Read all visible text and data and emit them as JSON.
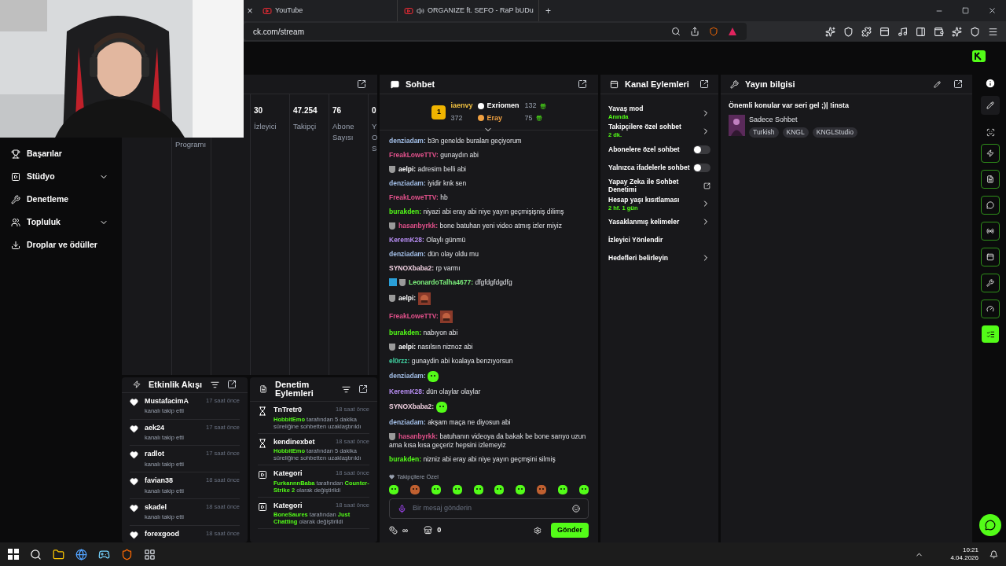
{
  "browser": {
    "tabs": [
      {
        "title": "YouTube",
        "selected": false,
        "audio": false
      },
      {
        "title": "ORGANIZE ft. SEFO - RaP bUDu",
        "selected": false,
        "audio": true
      }
    ],
    "close_mark": "×",
    "new_tab": "+",
    "address": "ck.com/stream"
  },
  "sidebar": {
    "items": [
      {
        "label": "Başarılar",
        "kind": "link"
      },
      {
        "label": "Stüdyo",
        "kind": "group"
      },
      {
        "label": "Denetleme",
        "kind": "link"
      },
      {
        "label": "Topluluk",
        "kind": "group"
      },
      {
        "label": "Droplar ve ödüller",
        "kind": "link"
      }
    ]
  },
  "stats": {
    "columns": [
      {
        "label": "Programı"
      },
      {},
      {
        "value": "30",
        "label": "İzleyici"
      },
      {
        "value": "47.254",
        "label": "Takipçi"
      },
      {
        "value": "76",
        "label": "Abone Sayısı"
      },
      {
        "value": "0",
        "label": "Y O S"
      }
    ]
  },
  "activity": {
    "title": "Etkinlik Akışı",
    "events": [
      {
        "user": "MustafacimA",
        "time": "17 saat önce",
        "action": "kanalı takip etti"
      },
      {
        "user": "aek24",
        "time": "17 saat önce",
        "action": "kanalı takip etti"
      },
      {
        "user": "radlot",
        "time": "17 saat önce",
        "action": "kanalı takip etti"
      },
      {
        "user": "favian38",
        "time": "18 saat önce",
        "action": "kanalı takip etti"
      },
      {
        "user": "skadel",
        "time": "18 saat önce",
        "action": "kanalı takip etti"
      },
      {
        "user": "forexgood",
        "time": "18 saat önce"
      }
    ]
  },
  "mod_actions": {
    "title": "Denetim Eylemleri",
    "items": [
      {
        "kind": "timeout",
        "title": "TnTretr0",
        "time": "18 saat önce",
        "text": "**HobbitEmo** tarafından 5 dakika süreliğine sohbetten uzaklaştırıldı"
      },
      {
        "kind": "timeout",
        "title": "kendinexbet",
        "time": "18 saat önce",
        "text": "**HobbitEmo** tarafından 5 dakika süreliğine sohbetten uzaklaştırıldı"
      },
      {
        "kind": "category",
        "title": "Kategori",
        "time": "18 saat önce",
        "text": "**FurkannnBaba** tarafından **Counter-Strike 2** olarak değiştirildi"
      },
      {
        "kind": "category",
        "title": "Kategori",
        "time": "18 saat önce",
        "text": "**BoneSaures** tarafından **Just Chatting** olarak değiştirildi"
      }
    ]
  },
  "chat": {
    "title": "Sohbet",
    "leaderboard": {
      "rank": "1",
      "first": {
        "user": "iaenvy",
        "count": "372"
      },
      "others": [
        {
          "user": "Exriomen",
          "count": "132",
          "color": "#ffffff"
        },
        {
          "user": "Eray",
          "count": "75",
          "color": "#f0a040"
        }
      ]
    },
    "messages": [
      {
        "user": "denziadam:",
        "color": "#a3bfe8",
        "kind": "text",
        "text": "b3n genelde buraları geçiyorum",
        "badge": false,
        "moderator": false
      },
      {
        "user": "FreakLoweTTV:",
        "color": "#e0508a",
        "kind": "text",
        "text": "gunaydın abi",
        "badge": false,
        "moderator": false
      },
      {
        "user": "aelpi:",
        "color": "#ffffff",
        "kind": "text",
        "text": "adresim belli abi",
        "badge": true,
        "moderator": false
      },
      {
        "user": "denziadam:",
        "color": "#a3bfe8",
        "kind": "text",
        "text": "iyidir knk sen",
        "badge": false,
        "moderator": false
      },
      {
        "user": "FreakLoweTTV:",
        "color": "#e0508a",
        "kind": "text",
        "text": "hb",
        "badge": false,
        "moderator": false
      },
      {
        "user": "burakden:",
        "color": "#53fc18",
        "kind": "text",
        "text": "niyazi abi eray abi niye yayın geçmişişniş dilimş",
        "badge": false,
        "moderator": false
      },
      {
        "user": "hasanbyrkk:",
        "color": "#e0508a",
        "kind": "text",
        "text": "bone batuhan yeni video atmış izler miyiz",
        "badge": true,
        "moderator": false
      },
      {
        "user": "KeremK28:",
        "color": "#b58cf0",
        "kind": "text",
        "text": "Olaylı günmü",
        "badge": false,
        "moderator": false
      },
      {
        "user": "denziadam:",
        "color": "#a3bfe8",
        "kind": "text",
        "text": "dün olay oldu mu",
        "badge": false,
        "moderator": false
      },
      {
        "user": "SYNOXbaba2:",
        "color": "#f0d0e0",
        "kind": "text",
        "text": "rp varmı",
        "badge": false,
        "moderator": false
      },
      {
        "user": "LeonardoTalha4677:",
        "color": "#7cf07c",
        "kind": "text",
        "text": "dfgfdgfdgdfg",
        "badge": true,
        "moderator": true
      },
      {
        "user": "aelpi:",
        "color": "#ffffff",
        "kind": "picture",
        "badge": true,
        "moderator": false
      },
      {
        "user": "FreakLoweTTV:",
        "color": "#e0508a",
        "kind": "picture",
        "badge": false,
        "moderator": false
      },
      {
        "user": "burakden:",
        "color": "#53fc18",
        "kind": "text",
        "text": "nabıyon abi",
        "badge": false,
        "moderator": false
      },
      {
        "user": "aelpi:",
        "color": "#ffffff",
        "kind": "text",
        "text": "nasılsın niznoz abi",
        "badge": true,
        "moderator": false
      },
      {
        "user": "el0rzz:",
        "color": "#40d0a0",
        "kind": "text",
        "text": "gunaydin abi koalaya benzıyorsun",
        "badge": false,
        "moderator": false
      },
      {
        "user": "denziadam:",
        "color": "#a3bfe8",
        "kind": "emote",
        "badge": false,
        "moderator": false
      },
      {
        "user": "KeremK28:",
        "color": "#b58cf0",
        "kind": "text",
        "text": "dün olaylar olaylar",
        "badge": false,
        "moderator": false
      },
      {
        "user": "SYNOXbaba2:",
        "color": "#f0d0e0",
        "kind": "emote",
        "badge": false,
        "moderator": false
      },
      {
        "user": "denziadam:",
        "color": "#a3bfe8",
        "kind": "text",
        "text": "akşam maça ne diyosun abi",
        "badge": false,
        "moderator": false
      },
      {
        "user": "hasanbyrkk:",
        "color": "#e0508a",
        "kind": "text",
        "text": "batuhanın videoya da bakak be bone sarıyo uzun ama kısa kısa geçeriz hepsini izlemeyiz",
        "badge": true,
        "moderator": false
      },
      {
        "user": "burakden:",
        "color": "#53fc18",
        "kind": "text",
        "text": "nizniz abi eray abi niye yayın geçmşini silmiş",
        "badge": false,
        "moderator": false
      }
    ],
    "emote_set": "Takipçilere Özel",
    "placeholder": "Bir mesaj gönderin",
    "points": "∞",
    "store_count": "0",
    "send": "Gönder"
  },
  "channel_actions": {
    "title": "Kanal Eylemleri",
    "items": [
      {
        "kind": "submenu",
        "label": "Yavaş mod",
        "value": "Anında"
      },
      {
        "kind": "submenu",
        "label": "Takipçilere özel sohbet",
        "value": "2 dk."
      },
      {
        "kind": "toggle",
        "label": "Abonelere özel sohbet",
        "on": false
      },
      {
        "kind": "toggle",
        "label": "Yalnızca ifadelerle sohbet",
        "on": false
      },
      {
        "kind": "external",
        "label": "Yapay Zeka ile Sohbet Denetimi"
      },
      {
        "kind": "submenu",
        "label": "Hesap yaşı kısıtlaması",
        "value": "2 hf. 1 gün"
      },
      {
        "kind": "submenu",
        "label": "Yasaklanmış kelimeler"
      },
      {
        "kind": "plain",
        "label": "İzleyici Yönlendir"
      },
      {
        "kind": "submenu",
        "label": "Hedefleri belirleyin"
      }
    ]
  },
  "stream_info": {
    "title": "Yayın bilgisi",
    "stream_title": "Önemli konular var seri gel ;)| !insta",
    "category": "Sadece Sohbet",
    "tags": [
      "Turkish",
      "KNGL",
      "KNGLStudio"
    ]
  },
  "taskbar": {
    "time": "10:21",
    "date": "4.04.2026"
  }
}
